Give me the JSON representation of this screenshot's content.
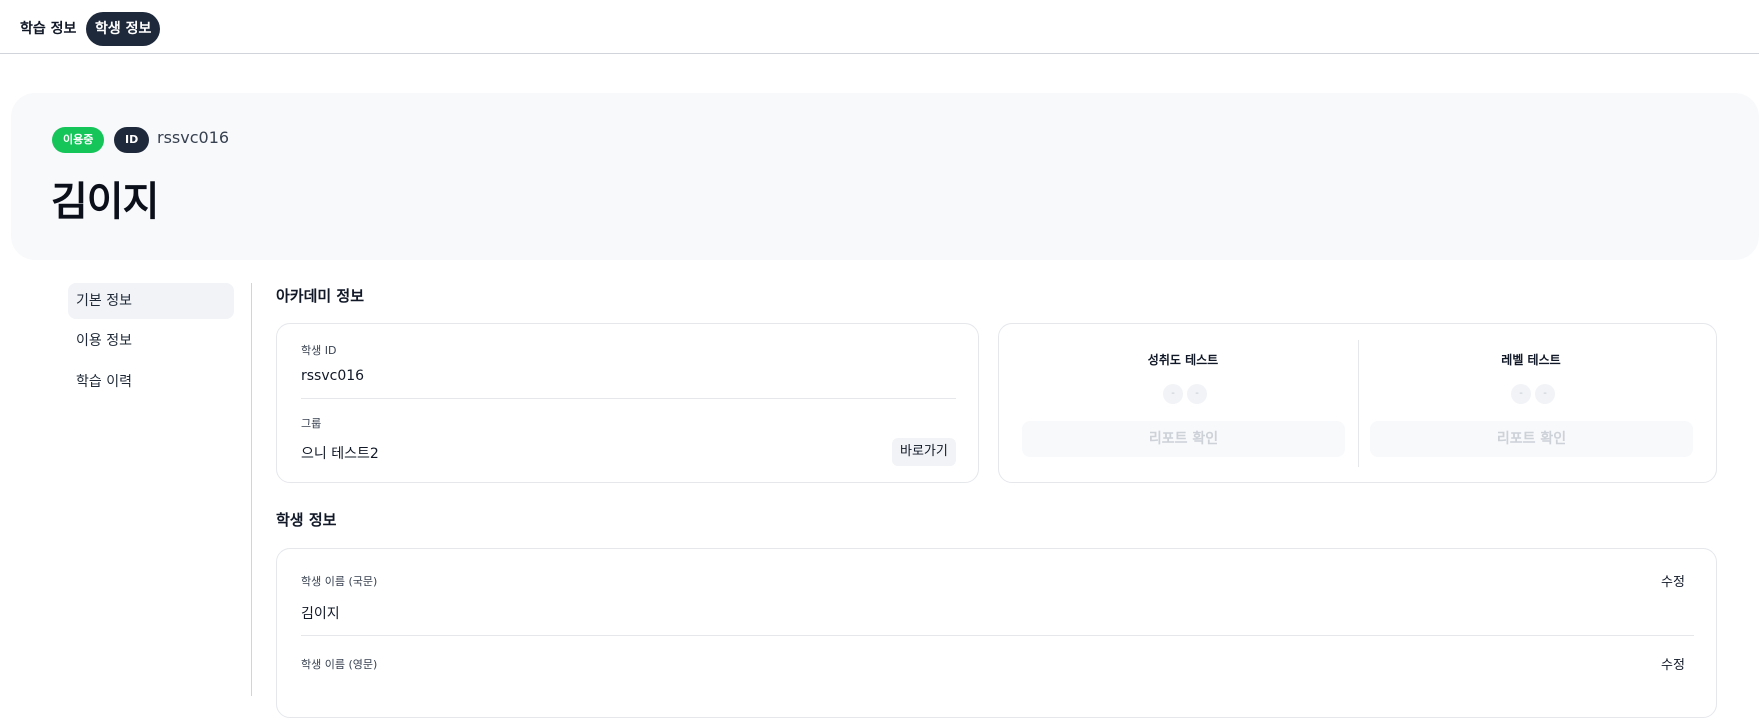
{
  "tabs": [
    {
      "label": "학습 정보"
    },
    {
      "label": "학생 정보"
    }
  ],
  "hero": {
    "status_badge": "이용중",
    "id_badge": "ID",
    "id_value": "rssvc016",
    "name": "김이지"
  },
  "nav": {
    "items": [
      {
        "label": "기본 정보"
      },
      {
        "label": "이용 정보"
      },
      {
        "label": "학습 이력"
      }
    ]
  },
  "academy": {
    "title": "아카데미 정보",
    "student_id_label": "학생 ID",
    "student_id_value": "rssvc016",
    "group_label": "그룹",
    "group_value": "으니 테스트2",
    "go_button": "바로가기",
    "achievement": {
      "title": "성취도 테스트",
      "dot1": "-",
      "dot2": "-",
      "report_button": "리포트 확인"
    },
    "level": {
      "title": "레벨 테스트",
      "dot1": "-",
      "dot2": "-",
      "report_button": "리포트 확인"
    }
  },
  "student": {
    "title": "학생 정보",
    "name_kr_label": "학생 이름 (국문)",
    "name_kr_value": "김이지",
    "name_en_label": "학생 이름 (영문)",
    "edit_label": "수정"
  }
}
